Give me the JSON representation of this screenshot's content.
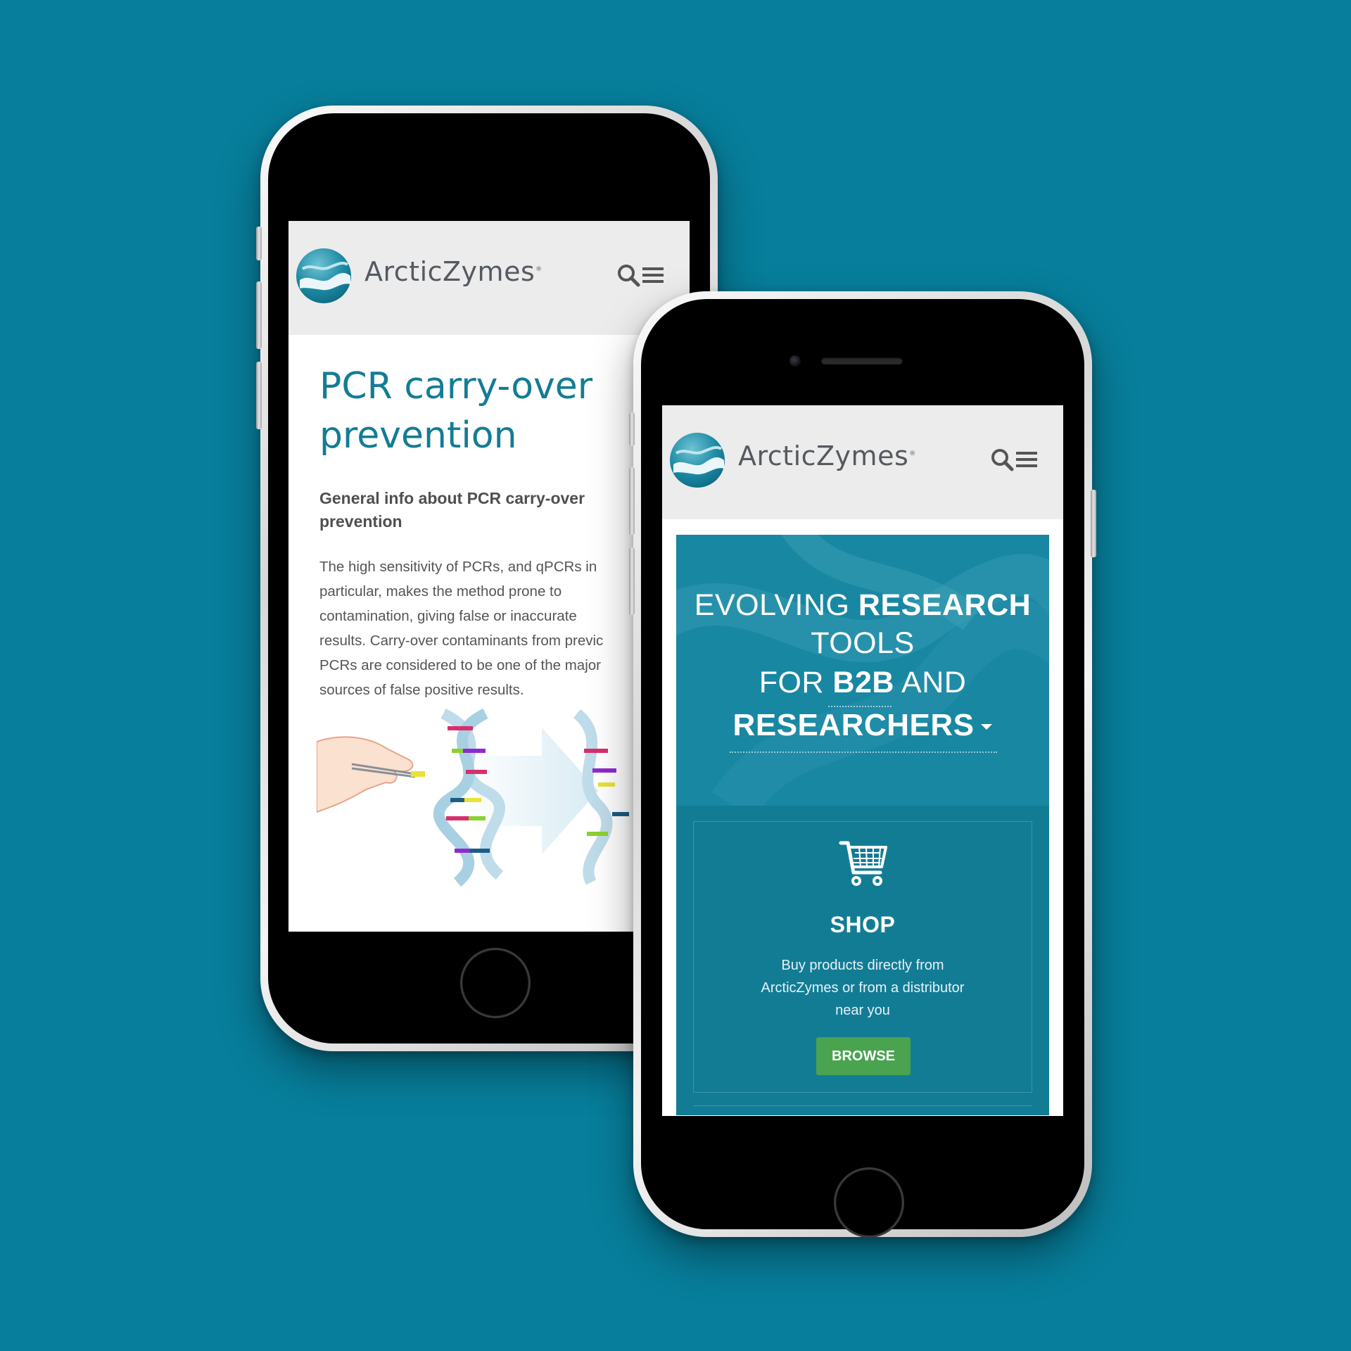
{
  "colors": {
    "background": "#077e9b",
    "brand_teal": "#137c95",
    "header_bg": "#ececec",
    "browse_green": "#4aa34f"
  },
  "brand": {
    "name": "ArcticZymes",
    "registered_mark": "®"
  },
  "header": {
    "search_icon": "search-icon",
    "menu_icon": "hamburger-menu-icon"
  },
  "left_phone": {
    "page_title_line1": "PCR carry-over",
    "page_title_line2": "prevention",
    "sub_heading": "General info about PCR carry-over prevention",
    "body_lines": [
      "The high sensitivity of PCRs, and qPCRs in",
      "particular, makes the method prone to",
      "contamination, giving false or inaccurate",
      "results. Carry-over contaminants from previc",
      "PCRs are considered to be one of the major",
      "sources of false positive results."
    ]
  },
  "right_phone": {
    "hero": {
      "line1_light": "EVOLVING ",
      "line1_bold": "RESEARCH",
      "line2": "TOOLS",
      "line3_light_a": "FOR ",
      "line3_bold": "B2B",
      "line3_light_b": " AND",
      "line4_bold": "RESEARCHERS"
    },
    "shop": {
      "icon": "shopping-cart-icon",
      "title": "SHOP",
      "description_lines": [
        "Buy products directly from",
        "ArcticZymes or from a distributor",
        "near you"
      ],
      "button_label": "BROWSE"
    }
  }
}
